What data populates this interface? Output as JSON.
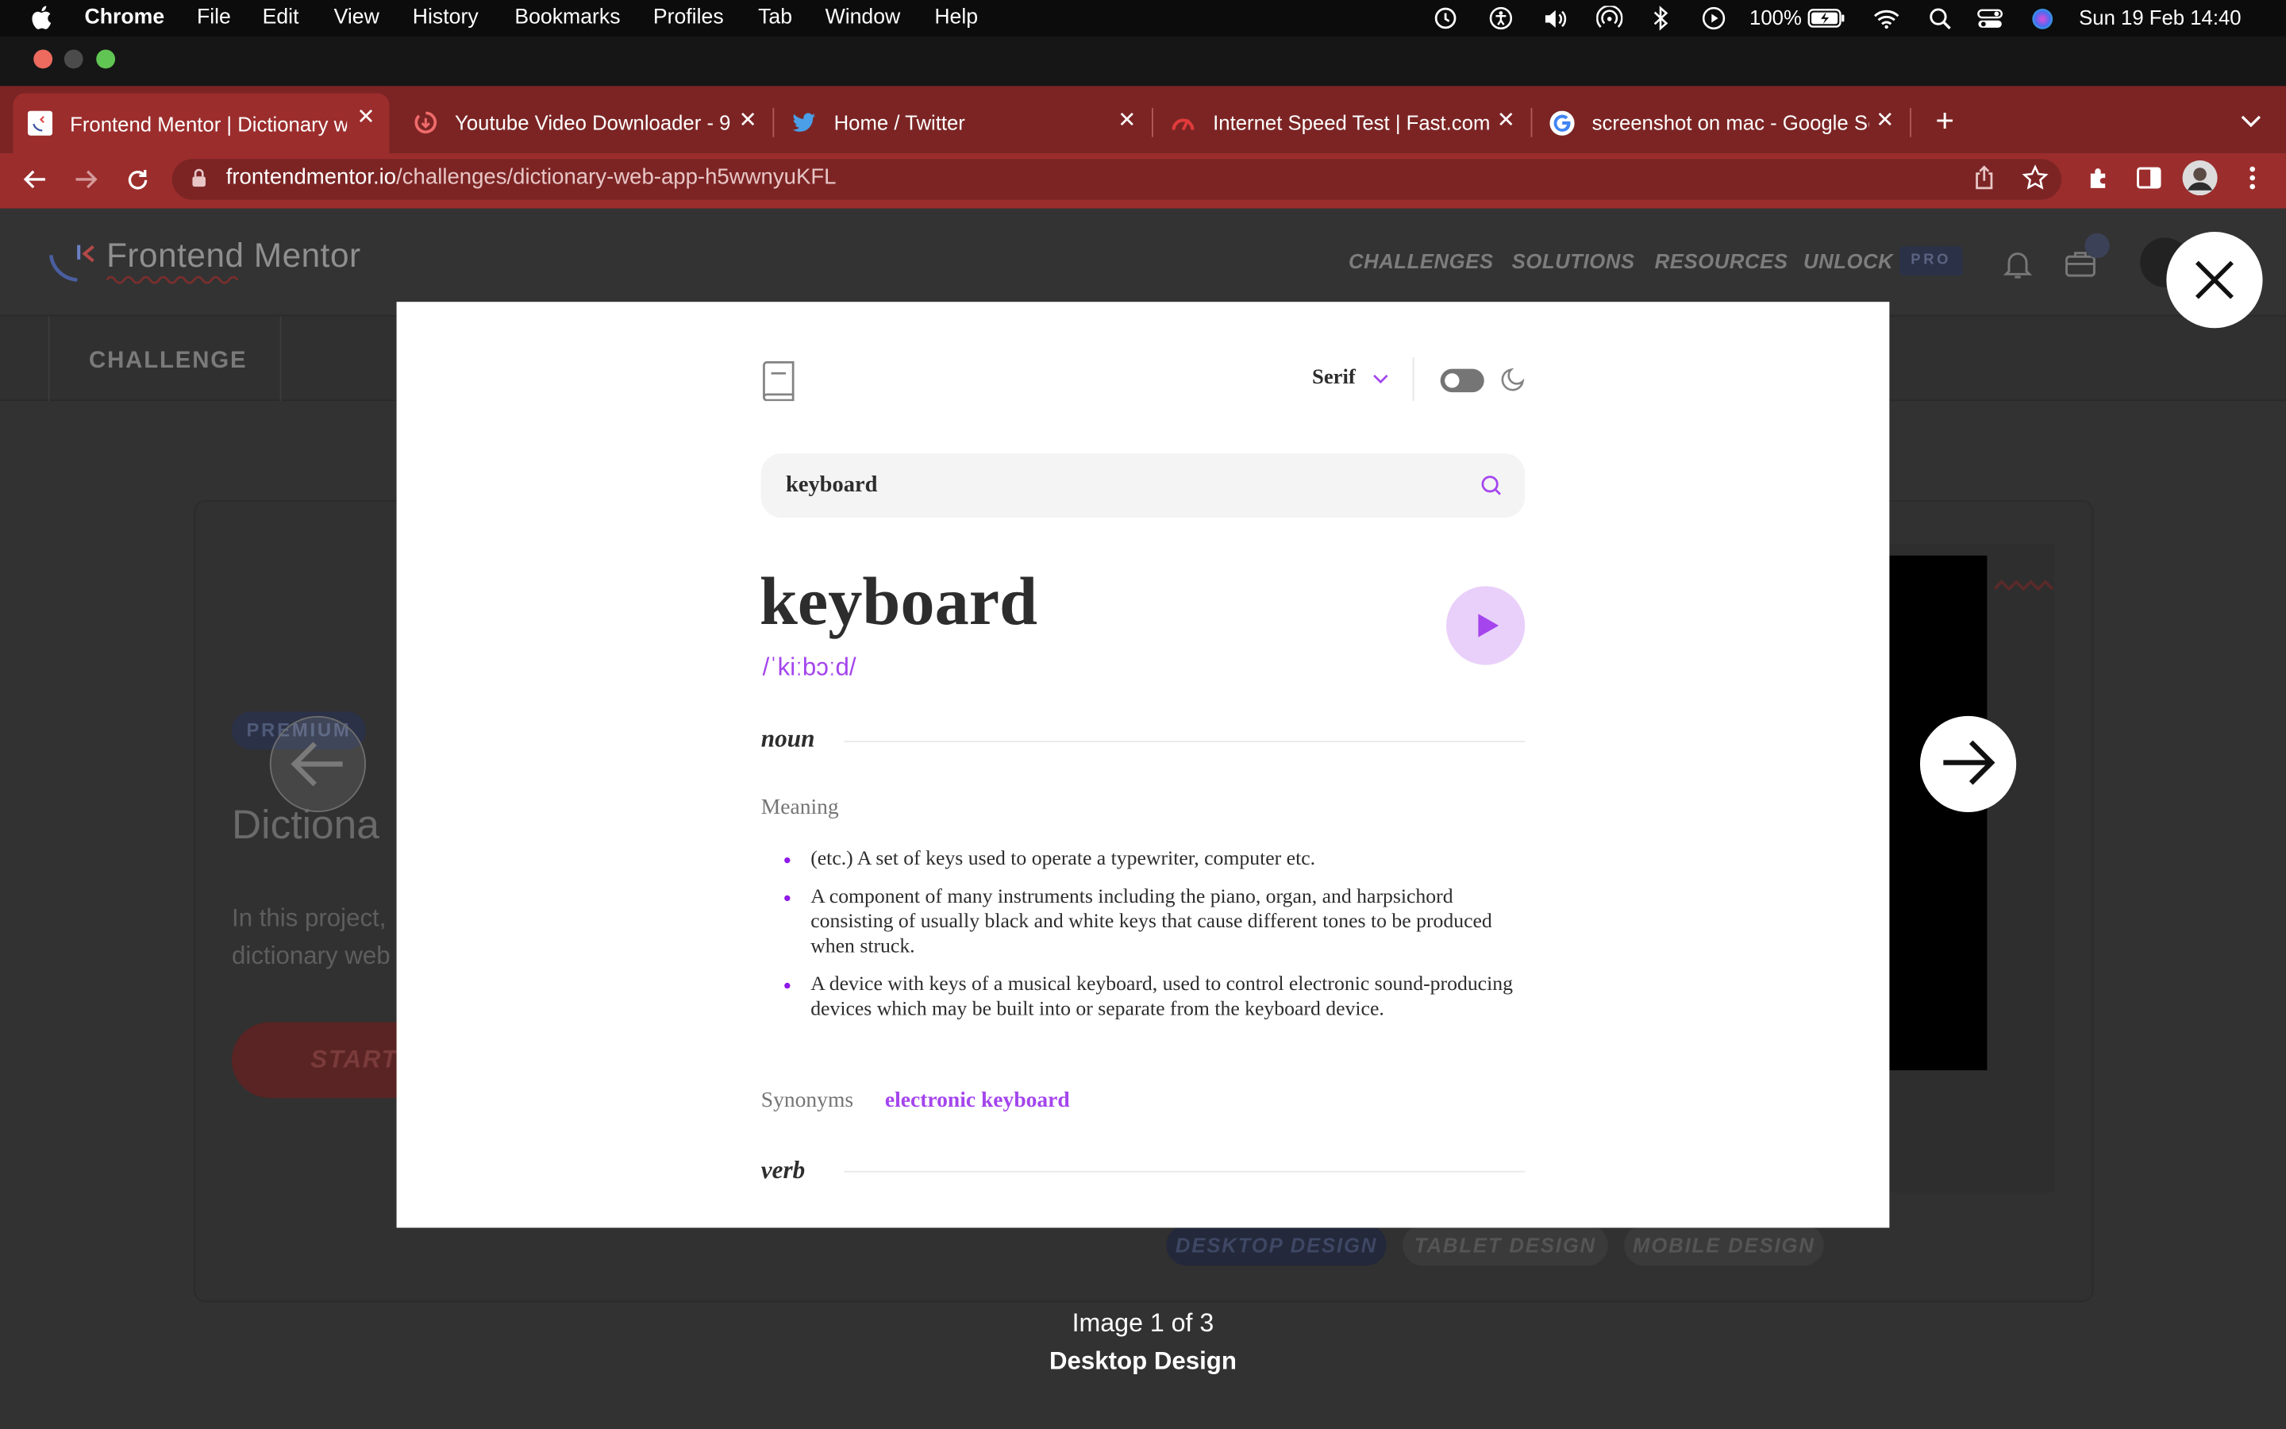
{
  "menubar": {
    "app": "Chrome",
    "items": [
      "File",
      "Edit",
      "View",
      "History",
      "Bookmarks",
      "Profiles",
      "Tab",
      "Window",
      "Help"
    ],
    "battery": "100%",
    "datetime": "Sun 19 Feb  14:40"
  },
  "tabs": [
    {
      "label": "Frontend Mentor | Dictionary w",
      "favicon": "frontend-mentor-icon"
    },
    {
      "label": "Youtube Video Downloader - 9",
      "favicon": "downloader-icon"
    },
    {
      "label": "Home / Twitter",
      "favicon": "twitter-icon"
    },
    {
      "label": "Internet Speed Test | Fast.com",
      "favicon": "fast-icon"
    },
    {
      "label": "screenshot on mac - Google Se",
      "favicon": "google-icon"
    }
  ],
  "address": {
    "domain": "frontendmentor.io",
    "path": "/challenges/dictionary-web-app-h5wwnyuKFL"
  },
  "site": {
    "logo": "Frontend Mentor",
    "nav": [
      "CHALLENGES",
      "SOLUTIONS",
      "RESOURCES",
      "UNLOCK"
    ],
    "pro": "PRO",
    "subnav": "CHALLENGE",
    "premium": "PREMIUM",
    "challenge_title": "Dictiona",
    "description_line1": "In this project,",
    "description_line2": "dictionary web",
    "start": "START",
    "design_tabs": [
      "DESKTOP DESIGN",
      "TABLET DESIGN",
      "MOBILE DESIGN"
    ]
  },
  "dictionary": {
    "font": "Serif",
    "search": "keyboard",
    "word": "keyboard",
    "phonetic": "/ˈkiːbɔːd/",
    "noun": "noun",
    "meaning_label": "Meaning",
    "definitions": [
      "(etc.) A set of keys used to operate a typewriter, computer etc.",
      "A component of many instruments including the piano, organ, and harpsichord consisting of usually black and white keys that cause different tones to be produced when struck.",
      "A device with keys of a musical keyboard, used to control electronic sound-producing devices which may be built into or separate from the keyboard device."
    ],
    "synonyms_label": "Synonyms",
    "synonym": "electronic keyboard",
    "verb": "verb",
    "accent_color": "#a445ed"
  },
  "lightbox": {
    "counter": "Image 1 of 3",
    "caption": "Desktop Design"
  }
}
